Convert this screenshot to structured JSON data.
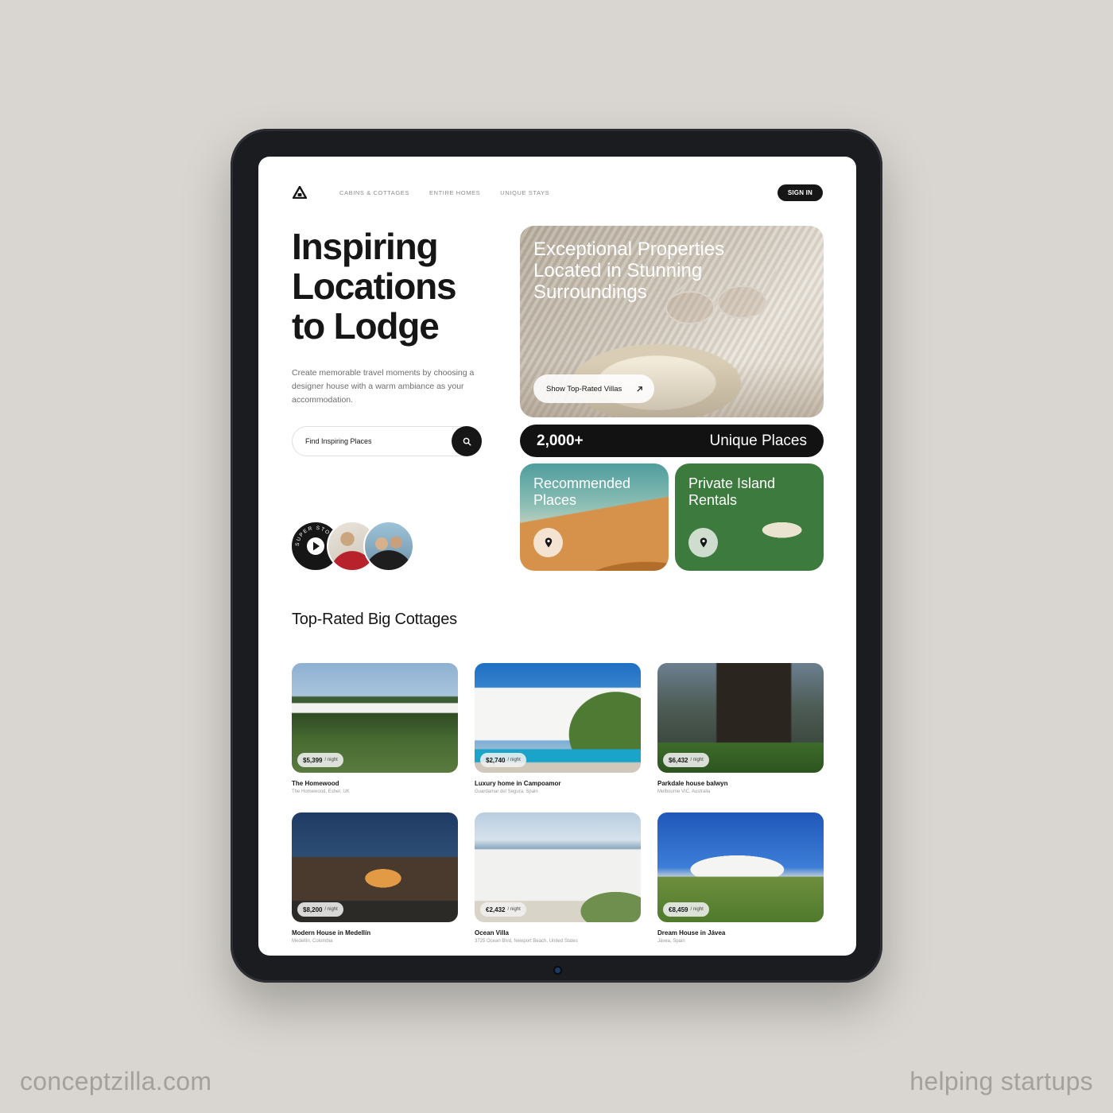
{
  "nav": {
    "links": [
      "CABINS & COTTAGES",
      "ENTIRE HOMES",
      "UNIQUE STAYS"
    ],
    "signin_label": "SIGN IN"
  },
  "hero": {
    "title_line1": "Inspiring",
    "title_line2": "Locations",
    "title_line3": "to Lodge",
    "subtitle": "Create memorable travel moments by choosing a designer house with a warm ambiance as your accommodation.",
    "search_placeholder": "Find Inspiring Places",
    "stories_label": "SUPER STORIES"
  },
  "feature": {
    "title": "Exceptional Properties Located in Stunning Surroundings",
    "button_label": "Show Top-Rated Villas"
  },
  "stat": {
    "number": "2,000+",
    "label": "Unique Places"
  },
  "mini_cards": [
    {
      "title": "Recommended Places"
    },
    {
      "title": "Private Island Rentals"
    }
  ],
  "listings": {
    "section_title": "Top-Rated Big Cottages",
    "price_unit": "/ night",
    "items": [
      {
        "price": "$5,399",
        "name": "The Homewood",
        "location": "The Homewood, Esher, UK"
      },
      {
        "price": "$2,740",
        "name": "Luxury home in Campoamor",
        "location": "Guardamar del Segura, Spain"
      },
      {
        "price": "$6,432",
        "name": "Parkdale house balwyn",
        "location": "Melbourne VIC, Australia"
      },
      {
        "price": "$8,200",
        "name": "Modern House in Medellín",
        "location": "Medellín, Colombia"
      },
      {
        "price": "€2,432",
        "name": "Ocean Villa",
        "location": "3725 Ocean Blvd, Newport Beach, United States"
      },
      {
        "price": "€8,459",
        "name": "Dream House in Jávea",
        "location": "Jávea, Spain"
      }
    ]
  },
  "footer": {
    "left": "conceptzilla.com",
    "right": "helping startups"
  },
  "colors": {
    "background": "#d9d6d1",
    "tablet_frame": "#1b1c20",
    "accent_dark": "#161616",
    "muted_text": "#8d8d8d"
  },
  "icons": [
    "home-logo-icon",
    "search-icon",
    "play-icon",
    "arrow-up-right-icon",
    "map-pin-icon"
  ]
}
